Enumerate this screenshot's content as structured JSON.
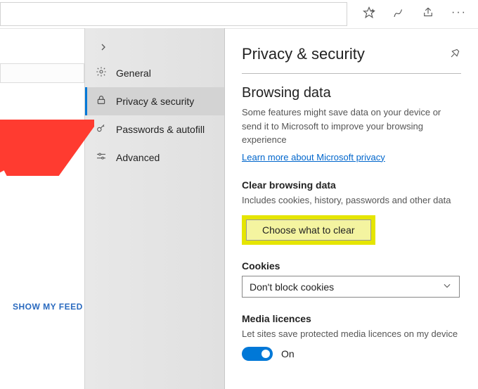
{
  "toolbar": {
    "icons": [
      "favorite-star-icon",
      "pen-icon",
      "share-icon",
      "more-icon"
    ]
  },
  "leftPane": {
    "showFeed": "SHOW MY FEED"
  },
  "nav": {
    "items": [
      {
        "icon": "⚙",
        "label": "General"
      },
      {
        "icon": "lock",
        "label": "Privacy & security"
      },
      {
        "icon": "🔍",
        "label": "Passwords & autofill"
      },
      {
        "icon": "⇄",
        "label": "Advanced"
      }
    ]
  },
  "details": {
    "title": "Privacy & security",
    "browsing": {
      "heading": "Browsing data",
      "body": "Some features might save data on your device or send it to Microsoft to improve your browsing experience",
      "link": "Learn more about Microsoft privacy"
    },
    "clear": {
      "heading": "Clear browsing data",
      "body": "Includes cookies, history, passwords and other data",
      "button": "Choose what to clear"
    },
    "cookies": {
      "heading": "Cookies",
      "value": "Don't block cookies"
    },
    "media": {
      "heading": "Media licences",
      "body": "Let sites save protected media licences on my device",
      "toggleState": "On"
    }
  }
}
